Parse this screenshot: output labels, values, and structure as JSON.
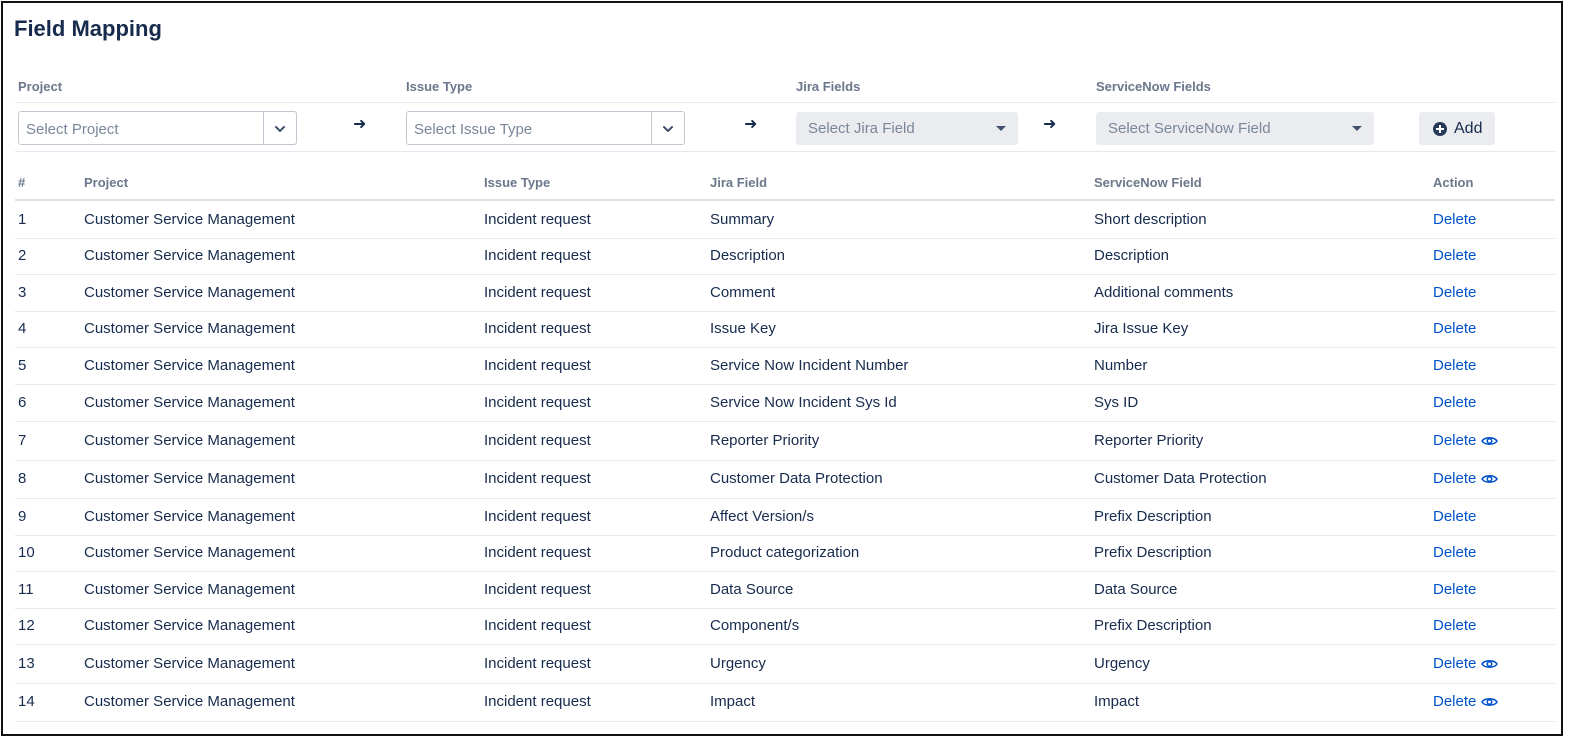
{
  "page": {
    "title": "Field Mapping"
  },
  "filters": {
    "project_label": "Project",
    "issue_type_label": "Issue Type",
    "jira_fields_label": "Jira Fields",
    "servicenow_fields_label": "ServiceNow Fields",
    "project_placeholder": "Select Project",
    "issue_type_placeholder": "Select Issue Type",
    "jira_field_placeholder": "Select Jira Field",
    "servicenow_field_placeholder": "Select ServiceNow Field",
    "arrow": "➜",
    "add_label": "Add"
  },
  "table": {
    "headers": {
      "num": "#",
      "project": "Project",
      "issue_type": "Issue Type",
      "jira_field": "Jira Field",
      "servicenow_field": "ServiceNow Field",
      "action": "Action"
    },
    "rows": [
      {
        "num": "1",
        "project": "Customer Service Management",
        "issue_type": "Incident request",
        "jira_field": "Summary",
        "servicenow_field": "Short description",
        "action": "Delete",
        "eye": false
      },
      {
        "num": "2",
        "project": "Customer Service Management",
        "issue_type": "Incident request",
        "jira_field": "Description",
        "servicenow_field": "Description",
        "action": "Delete",
        "eye": false
      },
      {
        "num": "3",
        "project": "Customer Service Management",
        "issue_type": "Incident request",
        "jira_field": "Comment",
        "servicenow_field": "Additional comments",
        "action": "Delete",
        "eye": false
      },
      {
        "num": "4",
        "project": "Customer Service Management",
        "issue_type": "Incident request",
        "jira_field": "Issue Key",
        "servicenow_field": "Jira Issue Key",
        "action": "Delete",
        "eye": false
      },
      {
        "num": "5",
        "project": "Customer Service Management",
        "issue_type": "Incident request",
        "jira_field": "Service Now Incident Number",
        "servicenow_field": "Number",
        "action": "Delete",
        "eye": false
      },
      {
        "num": "6",
        "project": "Customer Service Management",
        "issue_type": "Incident request",
        "jira_field": "Service Now Incident Sys Id",
        "servicenow_field": "Sys ID",
        "action": "Delete",
        "eye": false
      },
      {
        "num": "7",
        "project": "Customer Service Management",
        "issue_type": "Incident request",
        "jira_field": "Reporter Priority",
        "servicenow_field": "Reporter Priority",
        "action": "Delete",
        "eye": true
      },
      {
        "num": "8",
        "project": "Customer Service Management",
        "issue_type": "Incident request",
        "jira_field": "Customer Data Protection",
        "servicenow_field": "Customer Data Protection",
        "action": "Delete",
        "eye": true
      },
      {
        "num": "9",
        "project": "Customer Service Management",
        "issue_type": "Incident request",
        "jira_field": "Affect Version/s",
        "servicenow_field": "Prefix Description",
        "action": "Delete",
        "eye": false
      },
      {
        "num": "10",
        "project": "Customer Service Management",
        "issue_type": "Incident request",
        "jira_field": "Product categorization",
        "servicenow_field": "Prefix Description",
        "action": "Delete",
        "eye": false
      },
      {
        "num": "11",
        "project": "Customer Service Management",
        "issue_type": "Incident request",
        "jira_field": "Data Source",
        "servicenow_field": "Data Source",
        "action": "Delete",
        "eye": false
      },
      {
        "num": "12",
        "project": "Customer Service Management",
        "issue_type": "Incident request",
        "jira_field": "Component/s",
        "servicenow_field": "Prefix Description",
        "action": "Delete",
        "eye": false
      },
      {
        "num": "13",
        "project": "Customer Service Management",
        "issue_type": "Incident request",
        "jira_field": "Urgency",
        "servicenow_field": "Urgency",
        "action": "Delete",
        "eye": true
      },
      {
        "num": "14",
        "project": "Customer Service Management",
        "issue_type": "Incident request",
        "jira_field": "Impact",
        "servicenow_field": "Impact",
        "action": "Delete",
        "eye": true
      }
    ]
  },
  "colors": {
    "link": "#0052cc",
    "text": "#172b4d",
    "muted": "#6b778c",
    "control_bg": "#ebecf0"
  },
  "icons": {
    "view": "eye-icon",
    "add": "plus-circle-icon",
    "dropdown": "chevron-down-icon"
  }
}
